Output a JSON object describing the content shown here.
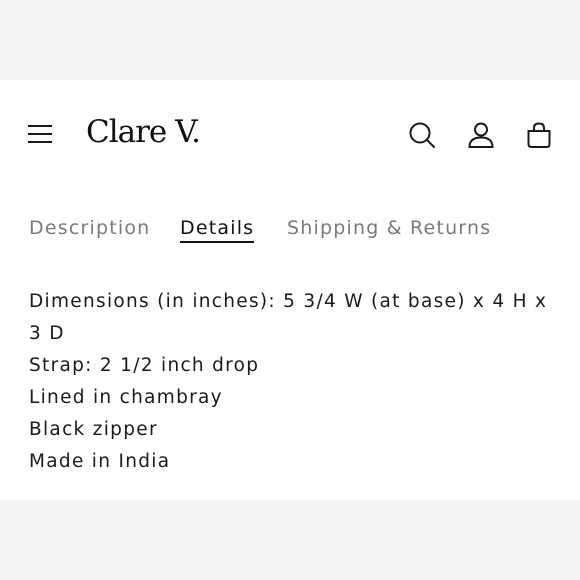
{
  "header": {
    "logo": "Clare V.",
    "icons": [
      "menu-icon",
      "search-icon",
      "account-icon",
      "bag-icon"
    ]
  },
  "tabs": [
    {
      "label": "Description",
      "active": false
    },
    {
      "label": "Details",
      "active": true
    },
    {
      "label": "Shipping & Returns",
      "active": false
    }
  ],
  "details": {
    "lines": [
      "Dimensions (in inches): 5 3/4 W (at base) x 4 H x 3 D",
      "Strap: 2 1/2 inch drop",
      "Lined in chambray",
      "Black zipper",
      "Made in India"
    ]
  }
}
